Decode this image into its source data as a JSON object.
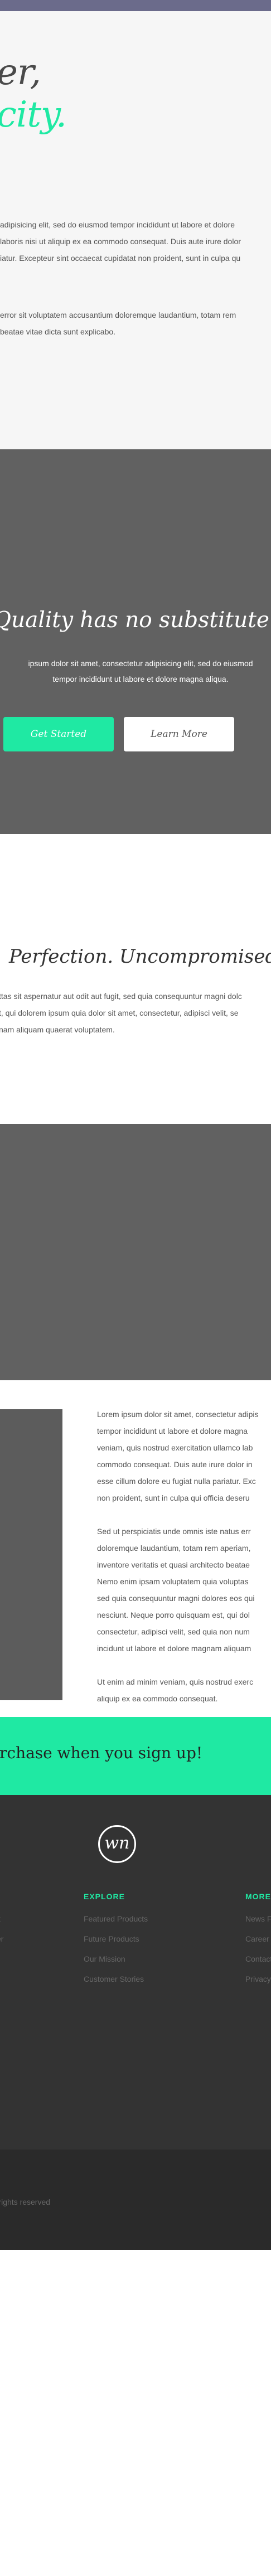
{
  "hero": {
    "title_line1": "er,",
    "title_line2": "city.",
    "para1_lines": [
      "adipisicing elit, sed do eiusmod tempor incididunt ut labore et dolore",
      "laboris nisi ut aliquip ex ea commodo consequat. Duis aute irure dolor",
      "iatur. Excepteur sint occaecat cupidatat non proident, sunt in culpa qu"
    ],
    "para2_lines": [
      "error sit voluptatem accusantium doloremque laudantium, totam rem",
      "beatae vitae dicta sunt explicabo."
    ]
  },
  "quality": {
    "title": "Quality has no substitute.",
    "text_lines": [
      "ipsum dolor sit amet, consectetur adipisicing elit, sed do eiusmod",
      "tempor incididunt ut labore et dolore magna aliqua."
    ],
    "primary_button": "Get Started",
    "secondary_button": "Learn More"
  },
  "perfection": {
    "title": "Perfection. Uncompromised.",
    "text_lines": [
      "ttas sit aspernatur aut odit aut fugit, sed quia consequuntur magni dolc",
      "t, qui dolorem ipsum quia dolor sit amet, consectetur, adipisci velit, se",
      "nam aliquam quaerat voluptatem."
    ]
  },
  "feature": {
    "para1_lines": [
      "Lorem ipsum dolor sit amet, consectetur adipis",
      "tempor incididunt ut labore et dolore magna",
      "veniam, quis nostrud exercitation ullamco lab",
      "commodo consequat. Duis aute irure dolor in",
      "esse cillum dolore eu fugiat nulla pariatur. Exc",
      "non proident, sunt in culpa qui officia deseru"
    ],
    "para2_lines": [
      "Sed ut perspiciatis unde omnis iste natus err",
      "doloremque laudantium, totam rem aperiam,",
      "inventore veritatis et quasi architecto beatae",
      "Nemo enim ipsam voluptatem quia voluptas",
      "sed quia consequuntur magni dolores eos qui",
      "nesciunt. Neque porro quisquam est, qui dol",
      "consectetur, adipisci velit, sed quia non num",
      "incidunt ut labore et dolore magnam aliquam"
    ],
    "para3_lines": [
      "Ut enim ad minim veniam, quis nostrud exerc",
      "aliquip ex ea commodo consequat."
    ]
  },
  "promo": {
    "text": "rchase when you sign up!"
  },
  "footer": {
    "logo": "wn",
    "left_links": [
      "k",
      "er"
    ],
    "explore_heading": "EXPLORE",
    "explore_links": [
      "Featured Products",
      "Future Products",
      "Our Mission",
      "Customer Stories"
    ],
    "more_heading": "MORE",
    "more_links": [
      "News Fe",
      "Career",
      "Contact",
      "Privacy P"
    ],
    "copyright": "All rights reserved"
  },
  "colors": {
    "accent": "#1fe9a3",
    "dark_band": "#616161",
    "footer_bg": "#333333",
    "topbar": "#6b6b8b"
  }
}
